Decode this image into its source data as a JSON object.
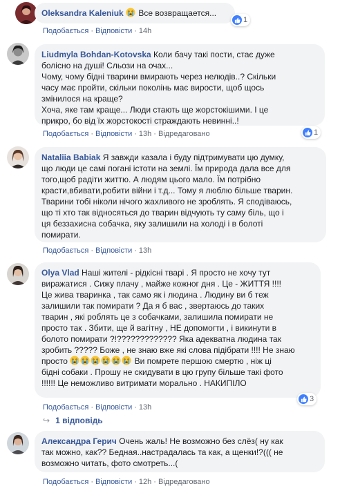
{
  "comments": [
    {
      "author": "Oleksandra Kaleniuk",
      "text": "Все возвращается...",
      "actions": {
        "like": "Подобається",
        "reply": "Відповісти",
        "time": "14h",
        "edited": ""
      },
      "reaction_count": "1"
    },
    {
      "author": "Liudmyla Bohdan-Kotovska",
      "lines": [
        "Коли бачу такі пости, стає дуже",
        "болісно на душі! Сльози на очах...",
        "Чому, чому бідні тварини вмирають через нелюдів..? Скільки",
        "часу має пройти, скільки поколінь має вирости, щоб щось",
        "змінилося на краще?",
        "Хоча, яке там краще... Люди стають ще жорстокішими. І це",
        "прикро, бо від їх жорстокості страждають невинні..!"
      ],
      "actions": {
        "like": "Подобається",
        "reply": "Відповісти",
        "time": "13h",
        "edited": "Відредаговано"
      },
      "reaction_count": "1"
    },
    {
      "author": "Nataliia Babiak",
      "lines": [
        "Я завжди казала і буду підтримувати цю думку,",
        "що люди це самі погані істоти на землі. Їм природа дала все для",
        "того,щоб радіти життю. А людям цього мало. Їм потрібно",
        "красти,вбивати,робити війни і т.д... Тому я люблю більше тварин.",
        "Тварини тобі ніколи нічого жахливого не зроблять. Я сподіваюсь,",
        "що ті хто так відносяться до тварин відчують ту саму біль, що і",
        "ця беззахисна собачка, яку залишили на холоді і в болоті",
        "помирати."
      ],
      "actions": {
        "like": "Подобається",
        "reply": "Відповісти",
        "time": "13h",
        "edited": ""
      },
      "reaction_count": ""
    },
    {
      "author": "Olya Vlad",
      "lines": [
        "Наші жителі - рідкісні тварі . Я просто не хочу тут",
        "виражатися . Сижу плачу , майже кожног дня . Це - ЖИТТЯ !!!!",
        "Це жива тваринка , так само як і людина . Людину ви б теж",
        "залишили так помирати ? Да я б вас , звертаюсь до таких",
        "тварин , які роблять це з собачками, залишила помирати не",
        "просто так . Збити, ще й вагітну , НЕ допомогти , і викинути в",
        "болото помирати ?!????????????? Яка адекватна людина так",
        "зробить ????? Боже , не знаю вже які слова підібрати !!!! Не знаю",
        "просто",
        "Ви помрете першою смертю , ніж ці",
        "бідні собаки . Прошу не скидувати в цю групу більше такі фото",
        "!!!!!! Це неможливо витримати морально . НАКИПІЛО"
      ],
      "actions": {
        "like": "Подобається",
        "reply": "Відповісти",
        "time": "13h",
        "edited": ""
      },
      "reaction_count": "3",
      "replies_label": "1 відповідь"
    },
    {
      "author": "Александра Герич",
      "lines": [
        "Очень жаль! Не возможно без слёз( ну как",
        "так можно, как?? Бедная..настрадалась та как, а щенки!?((( не",
        "возможно читать, фото смотреть...("
      ],
      "actions": {
        "like": "Подобається",
        "reply": "Відповісти",
        "time": "12h",
        "edited": "Відредаговано"
      },
      "reaction_count": ""
    }
  ],
  "colors": {
    "link": "#385898",
    "bubble": "#f2f3f5",
    "meta": "#606770",
    "like": "#4080ff"
  }
}
